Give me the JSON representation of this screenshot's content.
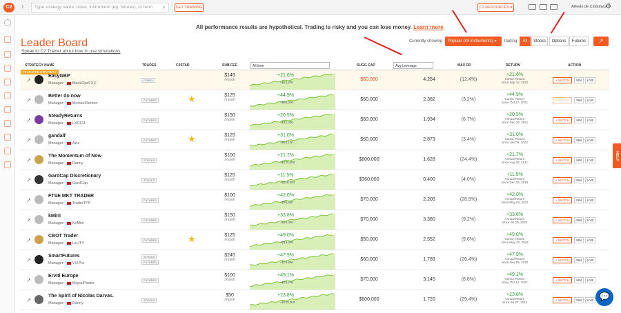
{
  "topbar": {
    "logo_text": "C2",
    "search_placeholder": "Type strategy name, ticker, instrument (eg. futures), or term",
    "get_training": "GET TRAINING",
    "c2_resources": "C2 RESOURCES",
    "user_name": "Alfredo de Cristofaro"
  },
  "page": {
    "title": "Leader Board",
    "subtitle": "Speak to C2 Trainer about how to use simulations",
    "disclaimer": "All performance results are hypothetical. Trading is risky and you can lose money.",
    "learn_more": "Learn more"
  },
  "filters": {
    "currently_showing": "Currently showing",
    "popular_dropdown": "Popular (All instruments)",
    "trading_label": "trading",
    "buttons": [
      "All",
      "Stocks",
      "Options",
      "Futures"
    ],
    "active_button": "All"
  },
  "table": {
    "headers": {
      "strategy_name": "STRATEGY NAME",
      "trades": "TRADES",
      "c2star": "C2STAR",
      "sub_fee": "SUB FEE",
      "time_dropdown": "All time",
      "sugg_cap": "SUGG CAP",
      "leverage_dropdown": "Avg Leverage",
      "max_dd": "MAX DD",
      "return": "RETURN",
      "action": "ACTION"
    },
    "featured_tag": "FEATURED STRATEGY",
    "action_labels": {
      "watch": "+ WATCH",
      "sim": "SIM",
      "live": "LIVE"
    },
    "rows": [
      {
        "name": "EasyGBP",
        "manager": "BlackOpzFXX",
        "tags": [
          "FOREX"
        ],
        "star": false,
        "fee": "$149",
        "fee_unit": "/month",
        "pct": "+21.6%",
        "amt": "+$12,200",
        "cap": "$60,000",
        "cap_red": true,
        "lev": "4.254",
        "dd": "(12.4%)",
        "ret": "+21.6%",
        "ret_label": "Cumul. Return",
        "ret_since": "since Sep 12, 2022",
        "featured": true
      },
      {
        "name": "Better do now",
        "manager": "MichaelRenton",
        "tags": [
          "FUTURES"
        ],
        "star": true,
        "fee": "$125",
        "fee_unit": "/month",
        "pct": "+44.9%",
        "amt": "+$18,000",
        "cap": "$60,000",
        "cap_red": false,
        "lev": "2.382",
        "dd": "(3.2%)",
        "ret": "+44.9%",
        "ret_label": "Cumul. Return",
        "ret_since": "since Oct 17, 2022"
      },
      {
        "name": "SteadyReturns",
        "manager": "LXC511",
        "tags": [
          "FUTURES"
        ],
        "star": false,
        "fee": "$150",
        "fee_unit": "/month",
        "pct": "+20.5%",
        "amt": "+$12,400",
        "cap": "$60,000",
        "cap_red": false,
        "lev": "1.934",
        "dd": "(6.7%)",
        "ret": "+20.5%",
        "ret_label": "Annual Return",
        "ret_since": "since Dec 28, 2021"
      },
      {
        "name": "gandalf",
        "manager": "Aziz",
        "tags": [
          "FUTURES"
        ],
        "star": true,
        "fee": "$125",
        "fee_unit": "/month",
        "pct": "+31.0%",
        "amt": "+$14,100",
        "cap": "$60,000",
        "cap_red": false,
        "lev": "2.873",
        "dd": "(3.4%)",
        "ret": "+31.0%",
        "ret_label": "Cumul. Return",
        "ret_since": "since Jan 09, 2023"
      },
      {
        "name": "The Momentum of Now",
        "manager": "Danny",
        "tags": [
          "STOCKS"
        ],
        "star": false,
        "fee": "$100",
        "fee_unit": "/month",
        "pct": "+21.7%",
        "amt": "+$720,000",
        "cap": "$800,000",
        "cap_red": false,
        "lev": "1.628",
        "dd": "(24.4%)",
        "ret": "+21.7%",
        "ret_label": "Annual Return",
        "ret_since": "since Aug 04, 2011"
      },
      {
        "name": "GardCap Discretionary",
        "manager": "GardCap",
        "tags": [
          "STOCKS"
        ],
        "star": false,
        "fee": "$125",
        "fee_unit": "/month",
        "pct": "+11.5%",
        "amt": "+$110,000",
        "cap": "$360,000",
        "cap_red": false,
        "lev": "0.400",
        "dd": "(4.0%)",
        "ret": "+11.5%",
        "ret_label": "Annual Return",
        "ret_since": "since Dec 03, 2019"
      },
      {
        "name": "FTSE MKT TRADER",
        "manager": "TraderTPP",
        "tags": [
          "FUTURES"
        ],
        "star": false,
        "fee": "$100",
        "fee_unit": "/month",
        "pct": "+42.0%",
        "amt": "+$35,600",
        "cap": "$70,000",
        "cap_red": false,
        "lev": "2.205",
        "dd": "(28.9%)",
        "ret": "+42.0%",
        "ret_label": "Annual Return",
        "ret_since": "since May 04, 2021"
      },
      {
        "name": "kMini",
        "manager": "KeMini",
        "tags": [
          "FUTURES"
        ],
        "star": false,
        "fee": "$150",
        "fee_unit": "/month",
        "pct": "+33.8%",
        "amt": "+$28,400",
        "cap": "$70,000",
        "cap_red": false,
        "lev": "3.380",
        "dd": "(9.2%)",
        "ret": "+33.8%",
        "ret_label": "Annual Return",
        "ret_since": "since Jul 20, 2020"
      },
      {
        "name": "CBOT Trader",
        "manager": "LiuJTY",
        "tags": [
          "FUTURES"
        ],
        "star": true,
        "fee": "$125",
        "fee_unit": "/month",
        "pct": "+49.0%",
        "amt": "+$18,300",
        "cap": "$50,000",
        "cap_red": false,
        "lev": "2.552",
        "dd": "(9.6%)",
        "ret": "+49.0%",
        "ret_label": "Cumul. Return",
        "ret_since": "since May 23, 2022"
      },
      {
        "name": "SmartFutures",
        "manager": "VIXPro",
        "tags": [
          "STOCKS",
          "FUTURES"
        ],
        "star": false,
        "fee": "$245",
        "fee_unit": "/month",
        "pct": "+47.9%",
        "amt": "+$79,800",
        "cap": "$60,000",
        "cap_red": false,
        "lev": "1.789",
        "dd": "(26.4%)",
        "ret": "+47.9%",
        "ret_label": "Annual Return",
        "ret_since": "since Nov 09, 2020"
      },
      {
        "name": "Erviti Europe",
        "manager": "MiguelPastor",
        "tags": [
          "FUTURES"
        ],
        "star": false,
        "fee": "$100",
        "fee_unit": "/month",
        "pct": "+49.1%",
        "amt": "+$25,200",
        "cap": "$70,000",
        "cap_red": false,
        "lev": "3.145",
        "dd": "(8.8%)",
        "ret": "+49.1%",
        "ret_label": "Cumul. Return",
        "ret_since": "since Oct 14, 2022"
      },
      {
        "name": "The Spirit of Nicolas Darvas.",
        "manager": "Danny",
        "tags": [
          "STOCKS"
        ],
        "star": false,
        "fee": "$50",
        "fee_unit": "/month",
        "pct": "+23.8%",
        "amt": "+$720,000",
        "cap": "$800,000",
        "cap_red": false,
        "lev": "1.720",
        "dd": "(29.4%)",
        "ret": "+23.8%",
        "ret_label": "Annual Return",
        "ret_since": "since Jul 07, 2013"
      }
    ]
  },
  "side": {
    "help": "HELP"
  },
  "colors": {
    "accent": "#f15a22",
    "positive": "#2a9a3a",
    "star": "#e8b923"
  }
}
